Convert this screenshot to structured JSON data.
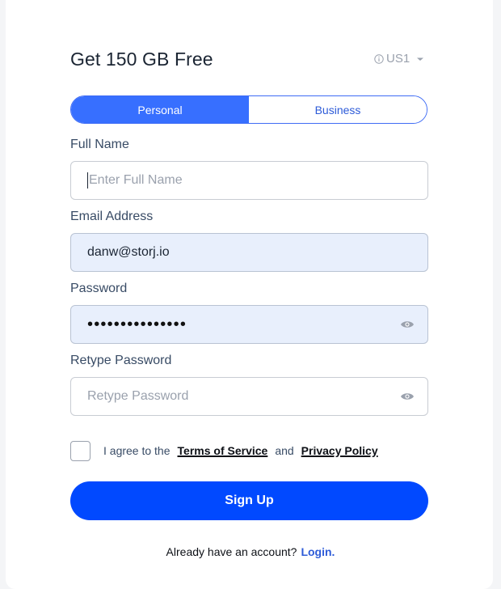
{
  "title": "Get 150 GB Free",
  "region": {
    "label": "US1",
    "icon": "info-icon"
  },
  "account_type": {
    "options": [
      "Personal",
      "Business"
    ],
    "selected": "Personal"
  },
  "full_name": {
    "label": "Full Name",
    "placeholder": "Enter Full Name",
    "value": ""
  },
  "email": {
    "label": "Email Address",
    "value": "danw@storj.io"
  },
  "password": {
    "label": "Password",
    "masked_value": "•••••••••••••••"
  },
  "retype_password": {
    "label": "Retype Password",
    "placeholder": "Retype Password",
    "value": ""
  },
  "terms": {
    "checked": false,
    "prefix": "I agree to the",
    "terms_link": "Terms of Service",
    "and": "and",
    "privacy_link": "Privacy Policy"
  },
  "signup_button": "Sign Up",
  "login": {
    "prompt": "Already have an account?",
    "link": "Login."
  },
  "colors": {
    "accent": "#0149ff",
    "toggle_active": "#376fff",
    "filled_field_bg": "#e8effc",
    "link": "#2d5bd8"
  }
}
